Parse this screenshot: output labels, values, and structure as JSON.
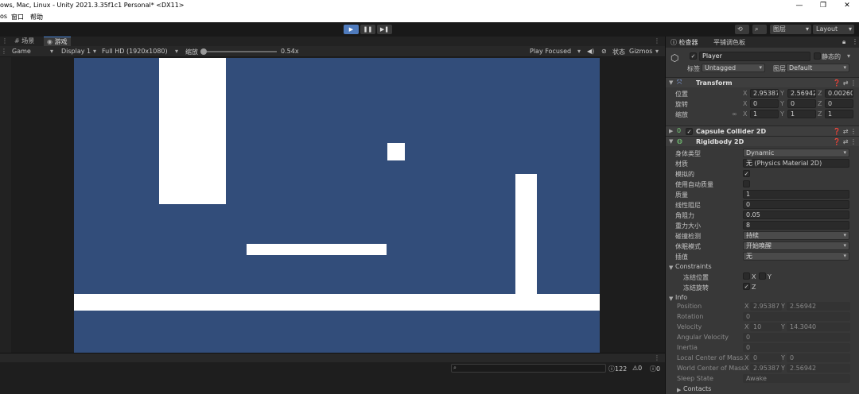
{
  "window": {
    "title": "ows, Mac, Linux - Unity 2021.3.35f1c1 Personal* <DX11>",
    "controls": [
      "—",
      "❐",
      "✕"
    ]
  },
  "menu": [
    "os",
    "窗口",
    "帮助"
  ],
  "toolbar": {
    "play_icon": "play-icon",
    "pause_icon": "pause-icon",
    "step_icon": "step-icon",
    "layers_label": "图层",
    "layout_label": "Layout"
  },
  "tabs": {
    "scene": "场景",
    "game": "游戏"
  },
  "game_toolbar": {
    "mode": "Game",
    "display": "Display 1",
    "resolution": "Full HD (1920x1080)",
    "scale_label": "缩放",
    "scale_value": "0.54x",
    "play_focused": "Play Focused",
    "stats": "状态",
    "gizmos": "Gizmos"
  },
  "game_view": {
    "background": "#324d7a",
    "wall_color": "#ffffff"
  },
  "console": {
    "counts": [
      "122",
      "0",
      "0"
    ]
  },
  "inspector": {
    "tabs": [
      "检查器",
      "平铺调色板"
    ],
    "object": {
      "name": "Player",
      "static_label": "静态的",
      "tag_label": "标签",
      "tag_value": "Untagged",
      "layer_label": "图层",
      "layer_value": "Default"
    },
    "transform": {
      "title": "Transform",
      "rows": [
        {
          "label": "位置",
          "x": "2.95387",
          "y": "2.56942",
          "z": "0.00260"
        },
        {
          "label": "旋转",
          "x": "0",
          "y": "0",
          "z": "0"
        },
        {
          "label": "缩放",
          "x": "1",
          "y": "1",
          "z": "1"
        }
      ]
    },
    "capsule": {
      "title": "Capsule Collider 2D"
    },
    "rigidbody": {
      "title": "Rigidbody 2D",
      "fields": [
        {
          "label": "身体类型",
          "value": "Dynamic",
          "kind": "dropdown"
        },
        {
          "label": "材质",
          "value": "无 (Physics Material 2D)",
          "kind": "object"
        },
        {
          "label": "模拟的",
          "value": "✓",
          "kind": "check"
        },
        {
          "label": "使用自动质量",
          "value": "",
          "kind": "check"
        },
        {
          "label": "质量",
          "value": "1",
          "kind": "field"
        },
        {
          "label": "线性阻尼",
          "value": "0",
          "kind": "field"
        },
        {
          "label": "角阻力",
          "value": "0.05",
          "kind": "field"
        },
        {
          "label": "重力大小",
          "value": "8",
          "kind": "field"
        },
        {
          "label": "碰撞检测",
          "value": "持续",
          "kind": "dropdown"
        },
        {
          "label": "休眠模式",
          "value": "开始唤醒",
          "kind": "dropdown"
        },
        {
          "label": "插值",
          "value": "无",
          "kind": "dropdown"
        }
      ],
      "constraints": {
        "title": "Constraints",
        "freeze_position": "冻结位置",
        "freeze_rotation": "冻结旋转",
        "x": "X",
        "y": "Y",
        "z": "Z"
      },
      "info": {
        "title": "Info",
        "rows": [
          {
            "label": "Position",
            "x": "2.95387",
            "y": "2.56942"
          },
          {
            "label": "Rotation",
            "value": "0"
          },
          {
            "label": "Velocity",
            "x": "10",
            "y": "14.3040"
          },
          {
            "label": "Angular Velocity",
            "value": "0"
          },
          {
            "label": "Inertia",
            "value": "0"
          },
          {
            "label": "Local Center of Mass",
            "x": "0",
            "y": "0"
          },
          {
            "label": "World Center of Mass",
            "x": "2.95387",
            "y": "2.56942"
          },
          {
            "label": "Sleep State",
            "value": "Awake"
          }
        ],
        "contacts": "Contacts"
      }
    }
  }
}
